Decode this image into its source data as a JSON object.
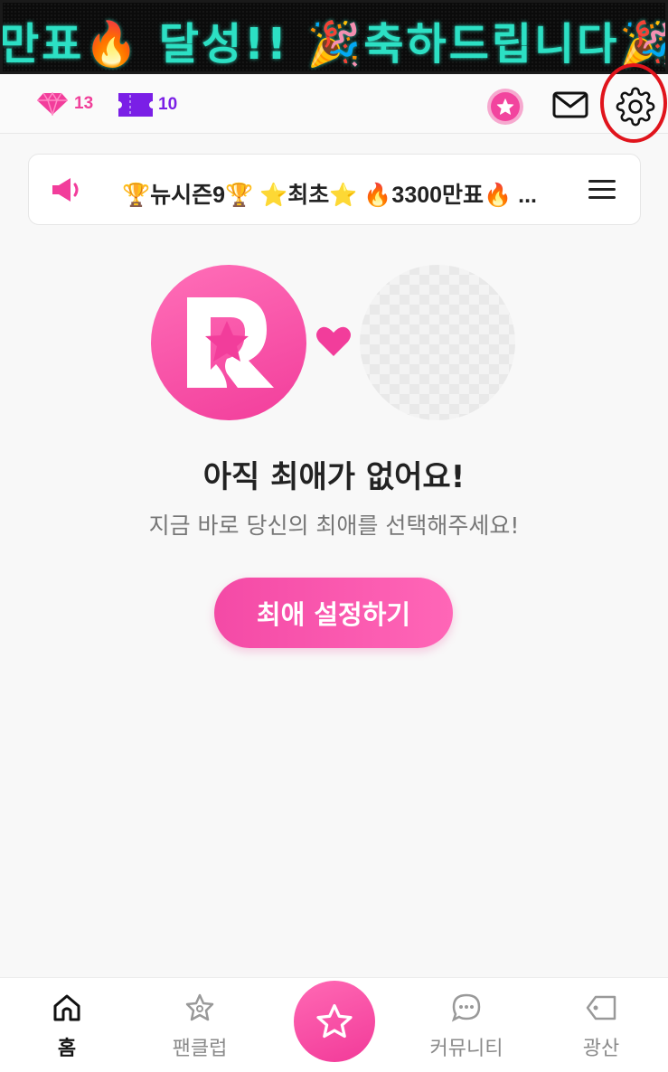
{
  "banner": {
    "text": "만표🔥 달성!! 🎉축하드립니다🎉"
  },
  "header": {
    "gem_count": "13",
    "ticket_count": "10"
  },
  "notice": {
    "text": "🏆뉴시즌9🏆 ⭐최초⭐ 🔥3300만표🔥 ..."
  },
  "hero": {
    "title": "아직 최애가 없어요!",
    "subtitle": "지금 바로 당신의 최애를 선택해주세요!",
    "cta_label": "최애 설정하기"
  },
  "bottom_nav": {
    "items": [
      {
        "label": "홈",
        "icon": "home-icon",
        "active": true
      },
      {
        "label": "팬클럽",
        "icon": "fanclub-star-icon",
        "active": false
      },
      {
        "label": "",
        "icon": "star-icon",
        "active": false
      },
      {
        "label": "커뮤니티",
        "icon": "chat-bubble-icon",
        "active": false
      },
      {
        "label": "광산",
        "icon": "tag-icon",
        "active": false
      }
    ]
  },
  "colors": {
    "brand_pink": "#f23d9b",
    "ticket_purple": "#7a1fe6",
    "highlight_red": "#e0141c",
    "led_text": "#2ce0c4"
  }
}
